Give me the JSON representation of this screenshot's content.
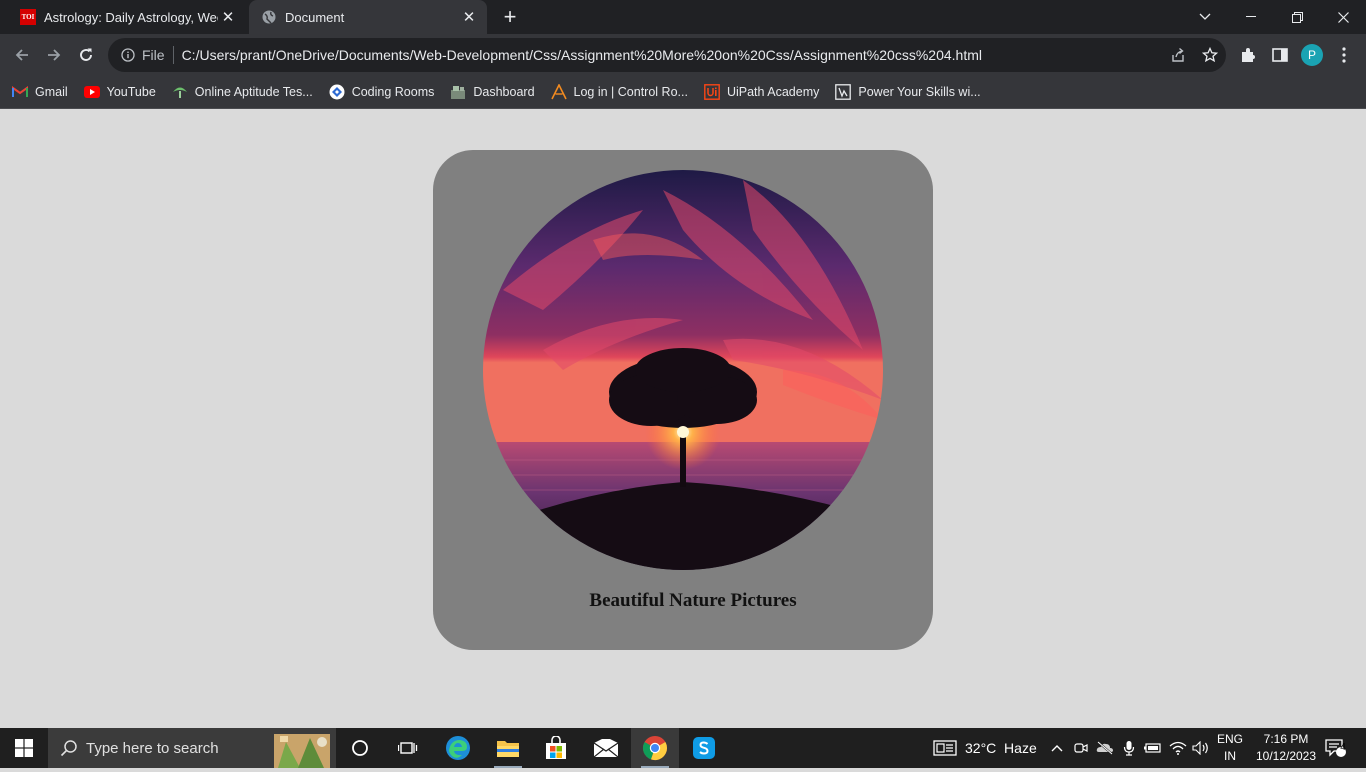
{
  "browser": {
    "tabs": [
      {
        "title": "Astrology: Daily Astrology, Weekly",
        "favicon": "TOI"
      },
      {
        "title": "Document"
      }
    ],
    "address": {
      "scheme_label": "File",
      "url": "C:/Users/prant/OneDrive/Documents/Web-Development/Css/Assignment%20More%20on%20Css/Assignment%20css%204.html"
    },
    "profile_initial": "P",
    "bookmarks": [
      {
        "label": "Gmail",
        "icon": "gmail-icon"
      },
      {
        "label": "YouTube",
        "icon": "youtube-icon"
      },
      {
        "label": "Online Aptitude Tes...",
        "icon": "aptitude-icon"
      },
      {
        "label": "Coding Rooms",
        "icon": "coding-rooms-icon"
      },
      {
        "label": "Dashboard",
        "icon": "dashboard-icon"
      },
      {
        "label": "Log in | Control Ro...",
        "icon": "control-room-icon"
      },
      {
        "label": "UiPath Academy",
        "icon": "uipath-icon"
      },
      {
        "label": "Power Your Skills wi...",
        "icon": "power-skills-icon"
      }
    ]
  },
  "page": {
    "caption": "Beautiful Nature Pictures",
    "image": "sunset-tree-icon"
  },
  "taskbar": {
    "search_placeholder": "Type here to search",
    "weather": "32°C  Haze",
    "lang_top": "ENG",
    "lang_bottom": "IN",
    "time": "7:16 PM",
    "date": "10/12/2023",
    "notifications": "4"
  }
}
